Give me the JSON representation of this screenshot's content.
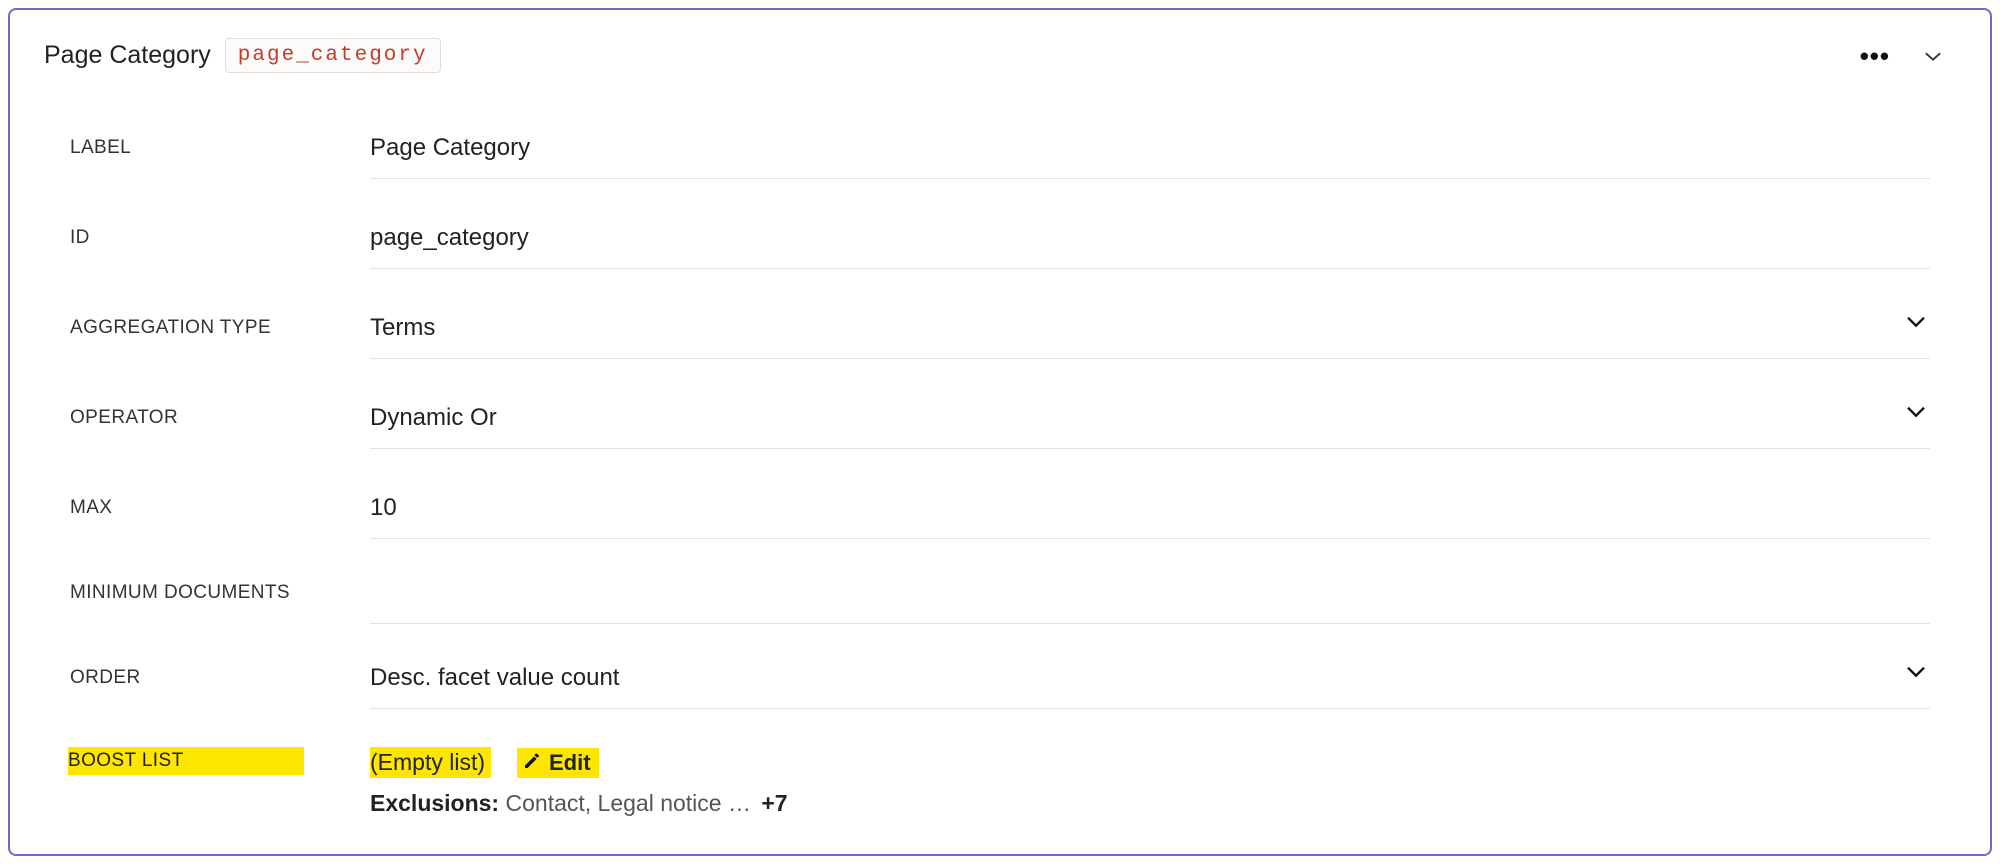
{
  "header": {
    "title": "Page Category",
    "code": "page_category"
  },
  "fields": {
    "label": {
      "caption": "LABEL",
      "value": "Page Category",
      "dropdown": false
    },
    "id": {
      "caption": "ID",
      "value": "page_category",
      "dropdown": false
    },
    "aggType": {
      "caption": "AGGREGATION TYPE",
      "value": "Terms",
      "dropdown": true
    },
    "operator": {
      "caption": "OPERATOR",
      "value": "Dynamic Or",
      "dropdown": true
    },
    "max": {
      "caption": "MAX",
      "value": "10",
      "dropdown": false
    },
    "minDocs": {
      "caption": "MINIMUM DOCUMENTS",
      "value": "",
      "dropdown": false
    },
    "order": {
      "caption": "ORDER",
      "value": "Desc. facet value count",
      "dropdown": true
    }
  },
  "boost": {
    "caption": "BOOST LIST",
    "emptyText": "(Empty list)",
    "editLabel": "Edit",
    "exclusionsLabel": "Exclusions:",
    "exclusionsPreview": "Contact, Legal notice …",
    "exclusionsMore": "+7"
  }
}
